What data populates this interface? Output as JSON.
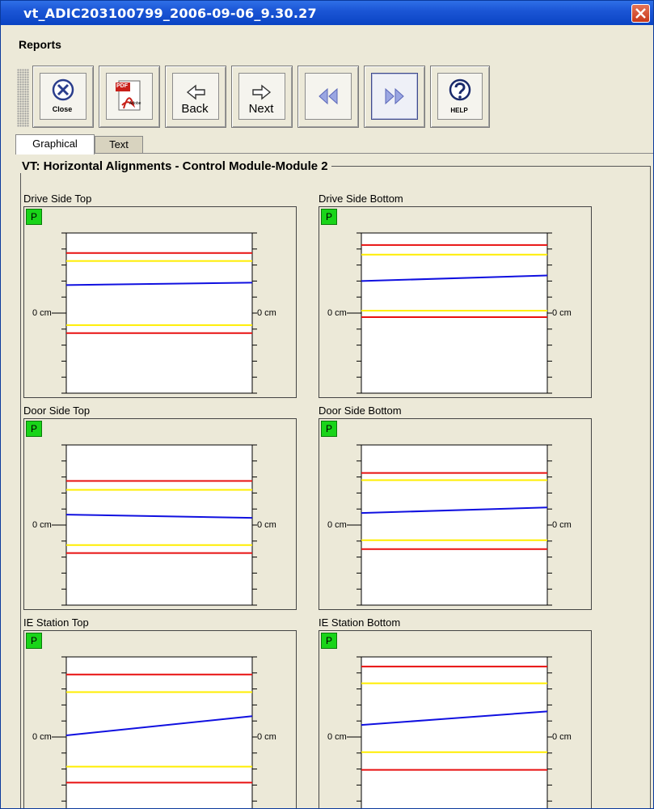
{
  "window": {
    "title": "vt_ADIC203100799_2006-09-06_9.30.27"
  },
  "menu": {
    "reports": "Reports"
  },
  "toolbar": {
    "close_label": "Close",
    "pdf_label": "PDF",
    "pdf_sub": "Adobe",
    "back_label": "Back",
    "next_label": "Next",
    "help_label": "HELP"
  },
  "tabs": [
    {
      "label": "Graphical",
      "active": true
    },
    {
      "label": "Text",
      "active": false
    }
  ],
  "group_title": "VT: Horizontal Alignments - Control Module-Module 2",
  "axis_zero_label": "0 cm",
  "status_badge": "P",
  "colors": {
    "limit_outer": "#e81010",
    "limit_inner": "#ffee00",
    "measurement": "#1010e0",
    "pass_badge": "#19d419"
  },
  "charts": [
    {
      "name": "drive-side-top",
      "title": "Drive Side Top",
      "status": "P",
      "outer_upper": 0.75,
      "inner_upper": 0.65,
      "outer_lower": -0.25,
      "inner_lower": -0.15,
      "line_start": 0.35,
      "line_end": 0.38
    },
    {
      "name": "drive-side-bottom",
      "title": "Drive Side Bottom",
      "status": "P",
      "outer_upper": 0.85,
      "inner_upper": 0.73,
      "outer_lower": -0.05,
      "inner_lower": 0.03,
      "line_start": 0.4,
      "line_end": 0.47
    },
    {
      "name": "door-side-top",
      "title": "Door Side Top",
      "status": "P",
      "outer_upper": 0.55,
      "inner_upper": 0.44,
      "outer_lower": -0.35,
      "inner_lower": -0.25,
      "line_start": 0.13,
      "line_end": 0.09
    },
    {
      "name": "door-side-bottom",
      "title": "Door Side Bottom",
      "status": "P",
      "outer_upper": 0.65,
      "inner_upper": 0.56,
      "outer_lower": -0.3,
      "inner_lower": -0.19,
      "line_start": 0.15,
      "line_end": 0.22
    },
    {
      "name": "ie-station-top",
      "title": "IE Station Top",
      "status": "P",
      "outer_upper": 0.78,
      "inner_upper": 0.56,
      "outer_lower": -0.57,
      "inner_lower": -0.37,
      "line_start": 0.02,
      "line_end": 0.26
    },
    {
      "name": "ie-station-bottom",
      "title": "IE Station Bottom",
      "status": "P",
      "outer_upper": 0.88,
      "inner_upper": 0.67,
      "outer_lower": -0.41,
      "inner_lower": -0.19,
      "line_start": 0.15,
      "line_end": 0.32
    }
  ]
}
